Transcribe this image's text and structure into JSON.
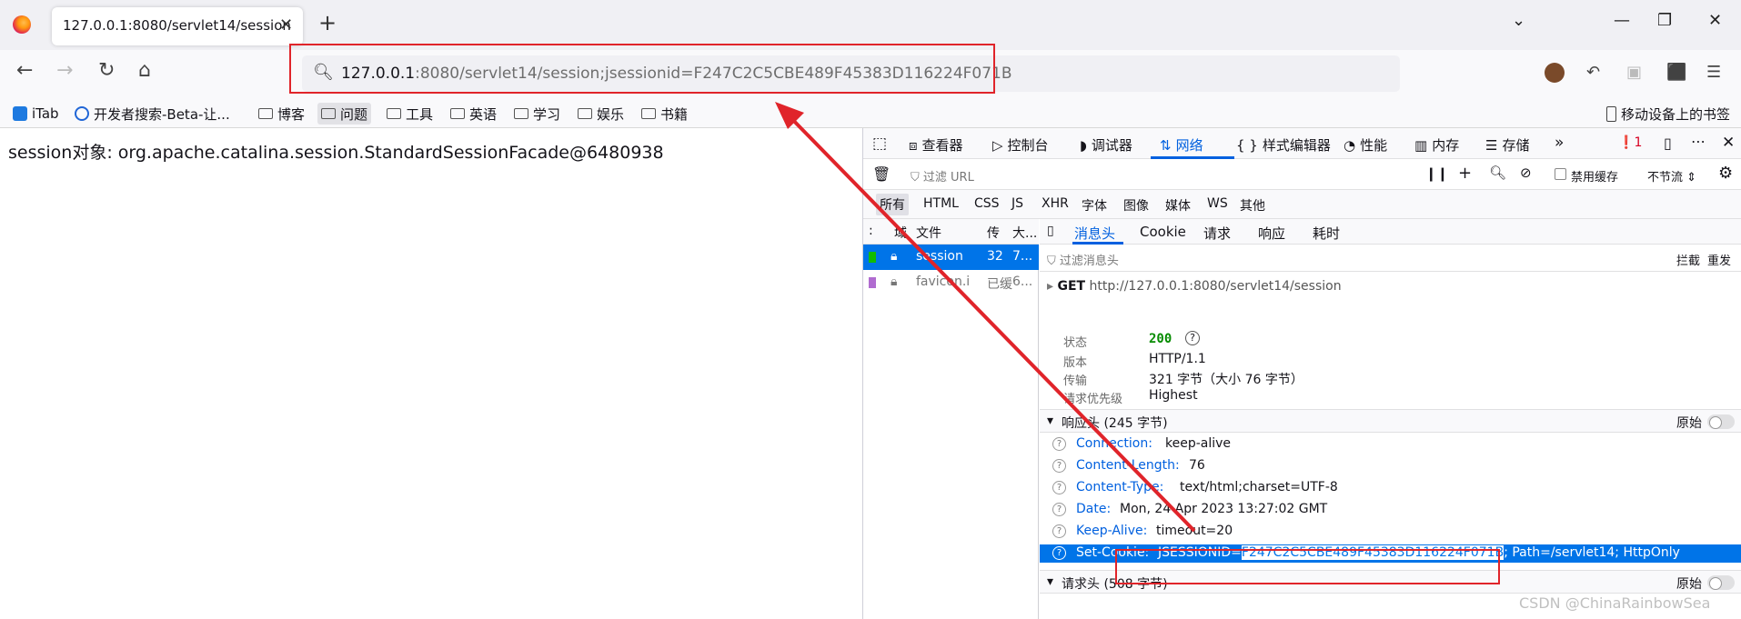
{
  "browser": {
    "tab_title": "127.0.0.1:8080/servlet14/session",
    "url_host": "127.0.0.1",
    "url_rest": ":8080/servlet14/session;jsessionid=F247C2C5CBE489F45383D116224F071B"
  },
  "bookmarks": {
    "items": [
      {
        "label": "iTab"
      },
      {
        "label": "开发者搜索-Beta-让..."
      },
      {
        "label": "博客"
      },
      {
        "label": "问题"
      },
      {
        "label": "工具"
      },
      {
        "label": "英语"
      },
      {
        "label": "学习"
      },
      {
        "label": "娱乐"
      },
      {
        "label": "书籍"
      }
    ],
    "mobile": "移动设备上的书签"
  },
  "page": {
    "text": "session对象: org.apache.catalina.session.StandardSessionFacade@6480938"
  },
  "devtools": {
    "tabs": [
      "查看器",
      "控制台",
      "调试器",
      "网络",
      "样式编辑器",
      "性能",
      "内存",
      "存储"
    ],
    "error_count": "1",
    "filter_placeholder": "过滤 URL",
    "disable_cache": "禁用缓存",
    "throttle": "不节流",
    "types": [
      "所有",
      "HTML",
      "CSS",
      "JS",
      "XHR",
      "字体",
      "图像",
      "媒体",
      "WS",
      "其他"
    ],
    "list_headers": {
      "domain": "域",
      "file": "文件",
      "transfer": "传",
      "size": "大..."
    },
    "requests": [
      {
        "file": "session",
        "transfer": "32",
        "size": "7..."
      },
      {
        "file": "favicon.i",
        "transfer": "已缓",
        "size": "6..."
      }
    ],
    "detail_tabs": [
      "消息头",
      "Cookie",
      "请求",
      "响应",
      "耗时"
    ],
    "detail_filter": "过滤消息头",
    "block": "拦截",
    "resend": "重发",
    "get": {
      "method": "GET",
      "url": "http://127.0.0.1:8080/servlet14/session"
    },
    "summary": [
      {
        "k": "状态",
        "v": "200"
      },
      {
        "k": "版本",
        "v": "HTTP/1.1"
      },
      {
        "k": "传输",
        "v": "321 字节（大小 76 字节）"
      },
      {
        "k": "请求优先级",
        "v": "Highest"
      }
    ],
    "response_section": "响应头 (245 字节)",
    "raw": "原始",
    "response_headers": [
      {
        "name": "Connection:",
        "value": "keep-alive"
      },
      {
        "name": "Content-Length:",
        "value": "76"
      },
      {
        "name": "Content-Type:",
        "value": "text/html;charset=UTF-8"
      },
      {
        "name": "Date:",
        "value": "Mon, 24 Apr 2023 13:27:02 GMT"
      },
      {
        "name": "Keep-Alive:",
        "value": "timeout=20"
      }
    ],
    "set_cookie": {
      "name": "Set-Cookie:",
      "prefix": "JSESSIONID=",
      "id": "F247C2C5CBE489F45383D116224F071B",
      "suffix": "; Path=/servlet14; HttpOnly"
    },
    "request_section": "请求头 (508 字节)"
  },
  "watermark": "CSDN @ChinaRainbowSea",
  "colors": {
    "accent": "#0060df",
    "selection": "#0074e8",
    "annotation": "#e0242a"
  }
}
